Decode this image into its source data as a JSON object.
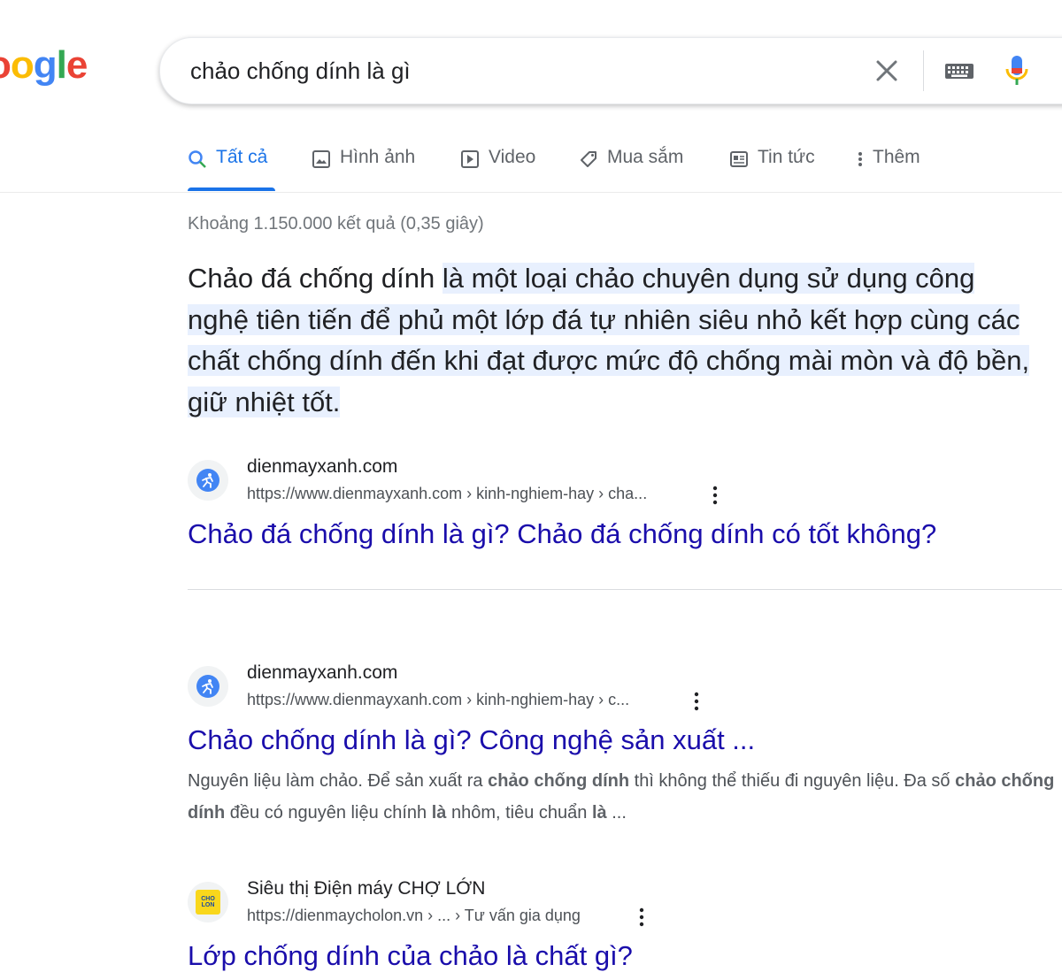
{
  "logo": {
    "text": "oogle"
  },
  "search": {
    "query": "chảo chống dính là gì"
  },
  "tabs": [
    {
      "label": "Tất cả",
      "icon": "search-icon",
      "active": true
    },
    {
      "label": "Hình ảnh",
      "icon": "image-icon"
    },
    {
      "label": "Video",
      "icon": "play-icon"
    },
    {
      "label": "Mua sắm",
      "icon": "tag-icon"
    },
    {
      "label": "Tin tức",
      "icon": "news-icon"
    },
    {
      "label": "Thêm",
      "icon": "more-vertical-icon"
    }
  ],
  "stats": "Khoảng 1.150.000 kết quả (0,35 giây)",
  "snippet": {
    "lead": "Chảo đá chống dính ",
    "highlight": "là một loại chảo chuyên dụng sử dụng công nghệ tiên tiến để phủ một lớp đá tự nhiên siêu nhỏ kết hợp cùng các chất chống dính đến khi đạt được mức độ chống mài mòn và độ bền, giữ nhiệt tốt."
  },
  "results": [
    {
      "site": "dienmayxanh.com",
      "url": "https://www.dienmayxanh.com › kinh-nghiem-hay › cha...",
      "title": "Chảo đá chống dính là gì? Chảo đá chống dính có tốt không?"
    },
    {
      "site": "dienmayxanh.com",
      "url": "https://www.dienmayxanh.com › kinh-nghiem-hay › c...",
      "title": "Chảo chống dính là gì? Công nghệ sản xuất ...",
      "desc": {
        "p1": "Nguyên liệu làm chảo. Để sản xuất ra ",
        "b1": "chảo chống dính",
        "p2": " thì không thể thiếu đi nguyên liệu. Đa số ",
        "b2": "chảo chống dính",
        "p3": " đều có nguyên liệu chính ",
        "b3": "là",
        "p4": " nhôm, tiêu chuẩn ",
        "b4": "là",
        "p5": " ..."
      }
    },
    {
      "site": "Siêu thị Điện máy CHỢ LỚN",
      "url": "https://dienmaycholon.vn › ... › Tư vấn gia dụng",
      "favicon_text": "CHO LON",
      "title": "Lớp chống dính của chảo là chất gì?"
    }
  ],
  "colors": {
    "link": "#1a0dab",
    "accent": "#1a73e8",
    "highlight": "#e8f0fe"
  }
}
